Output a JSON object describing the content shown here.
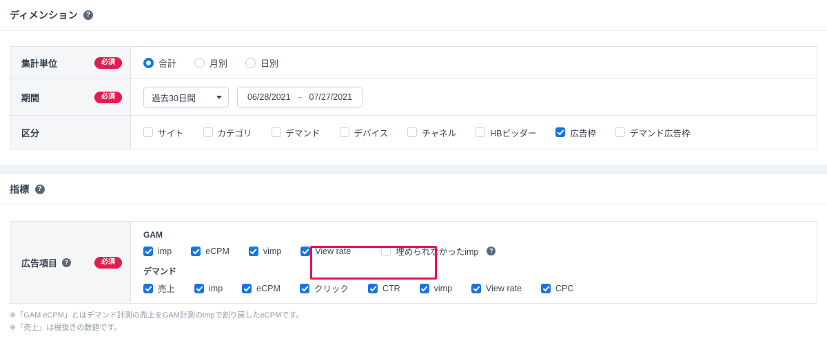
{
  "dimension": {
    "title": "ディメンション",
    "help_icon": "help-circle-icon",
    "rows": {
      "unit": {
        "label": "集計単位",
        "required_badge": "必須",
        "options": [
          {
            "label": "合計",
            "selected": true
          },
          {
            "label": "月別",
            "selected": false
          },
          {
            "label": "日別",
            "selected": false
          }
        ]
      },
      "period": {
        "label": "期間",
        "required_badge": "必須",
        "preset": "過去30日間",
        "caret_icon": "chevron-down-icon",
        "date_start": "06/28/2021",
        "date_separator": "–",
        "date_end": "07/27/2021"
      },
      "division": {
        "label": "区分",
        "options": [
          {
            "label": "サイト",
            "checked": false
          },
          {
            "label": "カテゴリ",
            "checked": false
          },
          {
            "label": "デマンド",
            "checked": false
          },
          {
            "label": "デバイス",
            "checked": false
          },
          {
            "label": "チャネル",
            "checked": false
          },
          {
            "label": "HBビッダー",
            "checked": false
          },
          {
            "label": "広告枠",
            "checked": true
          },
          {
            "label": "デマンド広告枠",
            "checked": false
          }
        ]
      }
    }
  },
  "metrics": {
    "title": "指標",
    "help_icon": "help-circle-icon",
    "row": {
      "label": "広告項目",
      "help_icon": "help-circle-icon",
      "required_badge": "必須",
      "groups": [
        {
          "name": "GAM",
          "options": [
            {
              "label": "imp",
              "checked": true
            },
            {
              "label": "eCPM",
              "checked": true
            },
            {
              "label": "vimp",
              "checked": true
            },
            {
              "label": "View rate",
              "checked": true
            },
            {
              "label": "埋められなかったimp",
              "checked": false,
              "help_icon": "help-circle-icon",
              "highlighted": true
            }
          ]
        },
        {
          "name": "デマンド",
          "options": [
            {
              "label": "売上",
              "checked": true
            },
            {
              "label": "imp",
              "checked": true
            },
            {
              "label": "eCPM",
              "checked": true
            },
            {
              "label": "クリック",
              "checked": true
            },
            {
              "label": "CTR",
              "checked": true
            },
            {
              "label": "vimp",
              "checked": true
            },
            {
              "label": "View rate",
              "checked": true
            },
            {
              "label": "CPC",
              "checked": true
            }
          ]
        }
      ]
    },
    "notes": [
      "※「GAM eCPM」とはデマンド計測の売上をGAM計測のimpで割り戻したeCPMです。",
      "※「売上」は税抜きの数値です。"
    ]
  },
  "colors": {
    "accent_blue": "#1575e6",
    "required_red": "#e8194f",
    "highlight_red": "#ee0f48",
    "border": "#dfe4ea",
    "label_bg": "#f4f6f8",
    "band_bg": "#f1f4f7"
  }
}
